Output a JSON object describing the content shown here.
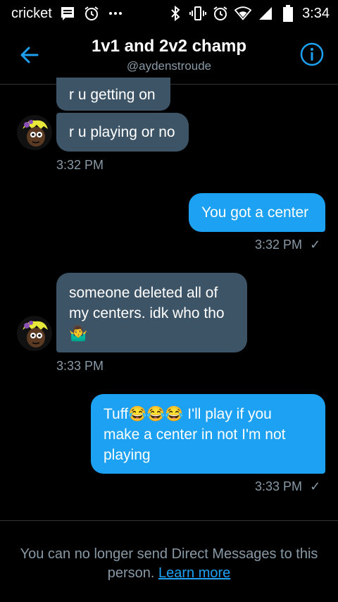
{
  "status_bar": {
    "carrier": "cricket",
    "time": "3:34",
    "icons": [
      "message-icon",
      "alarm-icon",
      "dots-icon",
      "bluetooth-icon",
      "vibrate-icon",
      "alarm-icon",
      "wifi-icon",
      "signal-icon",
      "battery-icon"
    ]
  },
  "header": {
    "title": "1v1 and 2v2 champ",
    "handle": "@aydenstroude"
  },
  "messages": [
    {
      "text": "r u getting on"
    },
    {
      "text": "r u playing or no"
    },
    {
      "time": "3:32 PM"
    },
    {
      "text": "You got a center",
      "time": "3:32 PM",
      "status": "✓"
    },
    {
      "text_line1": "someone deleted all of",
      "text_line2": "my centers. idk who tho",
      "emoji": "🤷‍♂️",
      "time": "3:33 PM"
    },
    {
      "text_line1": "Tuff😂😂😂 I'll play if you",
      "text_line2": "make a center in not I'm not",
      "text_line3": "playing",
      "time": "3:33 PM",
      "status": "✓"
    }
  ],
  "footer": {
    "text": "You can no longer send Direct Messages to this person.",
    "link": "Learn more"
  },
  "colors": {
    "accent": "#1da1f2",
    "incoming_bubble": "#3d5466",
    "muted": "#8899a6",
    "background": "#000000"
  }
}
